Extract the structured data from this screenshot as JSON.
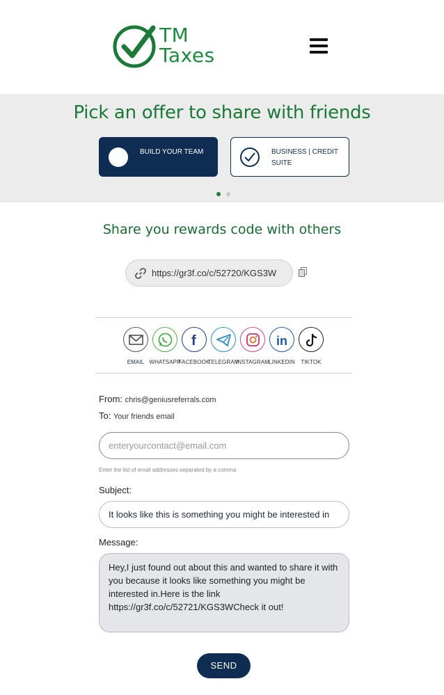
{
  "brand": {
    "logo_line1": "TM",
    "logo_line2": "Taxes",
    "color": "#1f8a3e"
  },
  "header": {
    "menu_icon": "hamburger-menu-icon"
  },
  "offers": {
    "title": "Pick an offer to share with friends",
    "items": [
      {
        "label": "BUILD YOUR TEAM",
        "selected": true
      },
      {
        "label": "BUSINESS | CREDIT SUITE",
        "selected": false
      }
    ],
    "pagination": {
      "current": 1,
      "total": 2
    }
  },
  "share": {
    "title": "Share you rewards code with others",
    "link": "https://gr3f.co/c/52720/KGS3W",
    "link_icon": "link-icon",
    "copy_icon": "copy-icon"
  },
  "social": [
    {
      "label": "EMAIL",
      "icon": "email-icon",
      "active": true
    },
    {
      "label": "WHATSAPP",
      "icon": "whatsapp-icon"
    },
    {
      "label": "FACEBOOK",
      "icon": "facebook-icon"
    },
    {
      "label": "TELEGRAM",
      "icon": "telegram-icon"
    },
    {
      "label": "INSTAGRAM",
      "icon": "instagram-icon"
    },
    {
      "label": "LINKEDIN",
      "icon": "linkedin-icon"
    },
    {
      "label": "TIKTOK",
      "icon": "tiktok-icon"
    }
  ],
  "form": {
    "from_label": "From:",
    "from_value": "chris@geniusreferrals.com",
    "to_label": "To:",
    "to_value": "Your friends email",
    "to_placeholder": "enteryourcontact@email.com",
    "to_hint": "Enter the list of email addresses separated by a comma",
    "subject_label": "Subject:",
    "subject_value": "It looks like this is something you might be interested in",
    "message_label": "Message:",
    "message_value": "Hey,I just found out about this and wanted to share it with you because it looks like something you might be interested in.Here is the link https://gr3f.co/c/52721/KGS3WCheck it out!",
    "send_label": "SEND"
  },
  "colors": {
    "navy": "#0f2c52",
    "green": "#1a7a38",
    "band": "#ececec"
  }
}
